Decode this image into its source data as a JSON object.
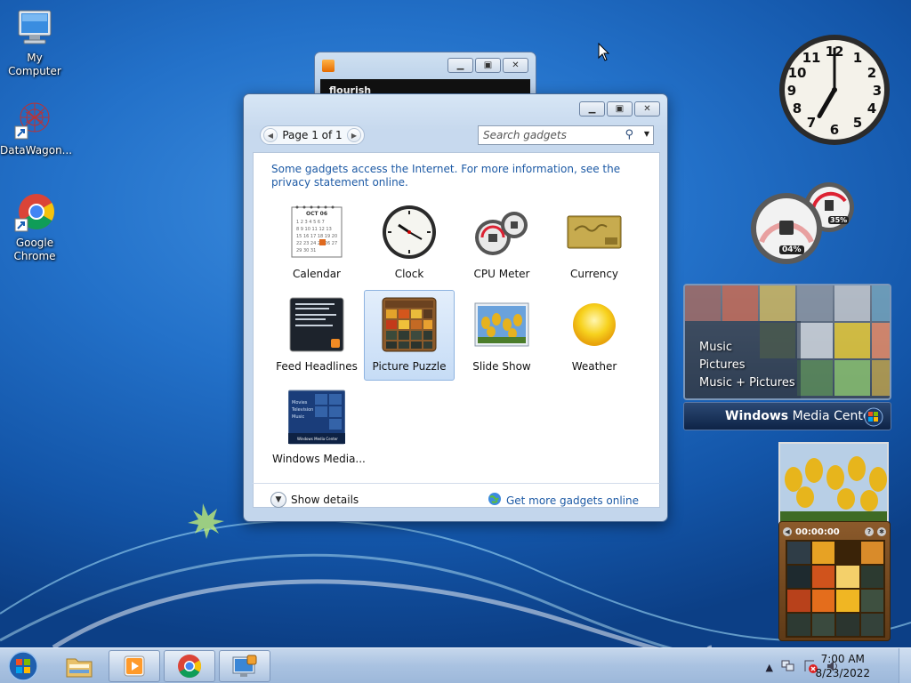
{
  "desktop": {
    "icons": [
      {
        "label": "My Computer"
      },
      {
        "label": "DataWagon..."
      },
      {
        "label": "Google Chrome"
      }
    ]
  },
  "media_player_mini": {
    "text": "flourish"
  },
  "gadgets_window": {
    "page_label": "Page 1 of 1",
    "search_placeholder": "Search gadgets",
    "notice": "Some gadgets access the Internet.  For more information, see the privacy statement online.",
    "gadgets": [
      {
        "label": "Calendar",
        "icon": "calendar-icon"
      },
      {
        "label": "Clock",
        "icon": "clock-icon"
      },
      {
        "label": "CPU Meter",
        "icon": "cpu-meter-icon"
      },
      {
        "label": "Currency",
        "icon": "currency-icon"
      },
      {
        "label": "Feed Headlines",
        "icon": "feed-headlines-icon"
      },
      {
        "label": "Picture Puzzle",
        "icon": "picture-puzzle-icon",
        "selected": true
      },
      {
        "label": "Slide Show",
        "icon": "slide-show-icon"
      },
      {
        "label": "Weather",
        "icon": "weather-icon"
      },
      {
        "label": "Windows Media...",
        "icon": "windows-media-center-icon"
      }
    ],
    "show_details": "Show details",
    "get_more": "Get more gadgets online"
  },
  "thumb_text": {
    "calendar_month": "OCT 06",
    "wmc_thumb_lines": [
      "Movies",
      "Television",
      "Music"
    ],
    "wmc_thumb_footer": "Windows Media Center"
  },
  "desktop_gadgets": {
    "clock": {
      "hour": 7,
      "minute": 0
    },
    "cpu_meter": {
      "cpu": "04%",
      "memory": "35%"
    },
    "wmc": {
      "menu": [
        "Music",
        "Pictures",
        "Music + Pictures"
      ],
      "title_bold": "Windows",
      "title_rest": " Media Center"
    },
    "puzzle": {
      "timer": "00:00:00"
    }
  },
  "taskbar": {
    "time": "7:00 AM",
    "date": "8/23/2022"
  }
}
